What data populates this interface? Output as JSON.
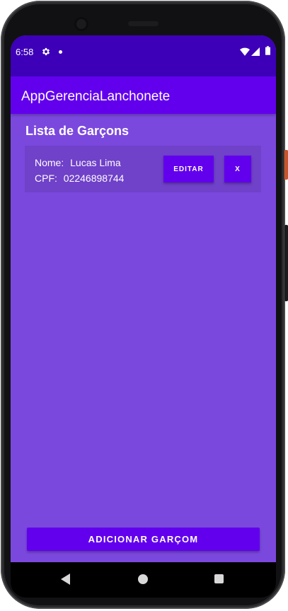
{
  "status_bar": {
    "time": "6:58",
    "icons": [
      "gear-icon",
      "notification-dot-icon",
      "wifi-icon",
      "signal-icon",
      "battery-icon"
    ]
  },
  "app_bar": {
    "title": "AppGerenciaLanchonete"
  },
  "main": {
    "list_title": "Lista de Garçons",
    "waiters": [
      {
        "name_label": "Nome:",
        "name": "Lucas Lima",
        "cpf_label": "CPF:",
        "cpf": "02246898744",
        "edit_label": "EDITAR",
        "delete_label": "X"
      }
    ],
    "add_button_label": "ADICIONAR GARÇOM"
  },
  "nav_bar": {
    "icons": [
      "back-icon",
      "home-icon",
      "recents-icon"
    ]
  },
  "colors": {
    "status_bar": "#3d00b8",
    "app_bar": "#6200ee",
    "background": "#7b48de",
    "card": "#7041c9",
    "button": "#6200ee"
  }
}
